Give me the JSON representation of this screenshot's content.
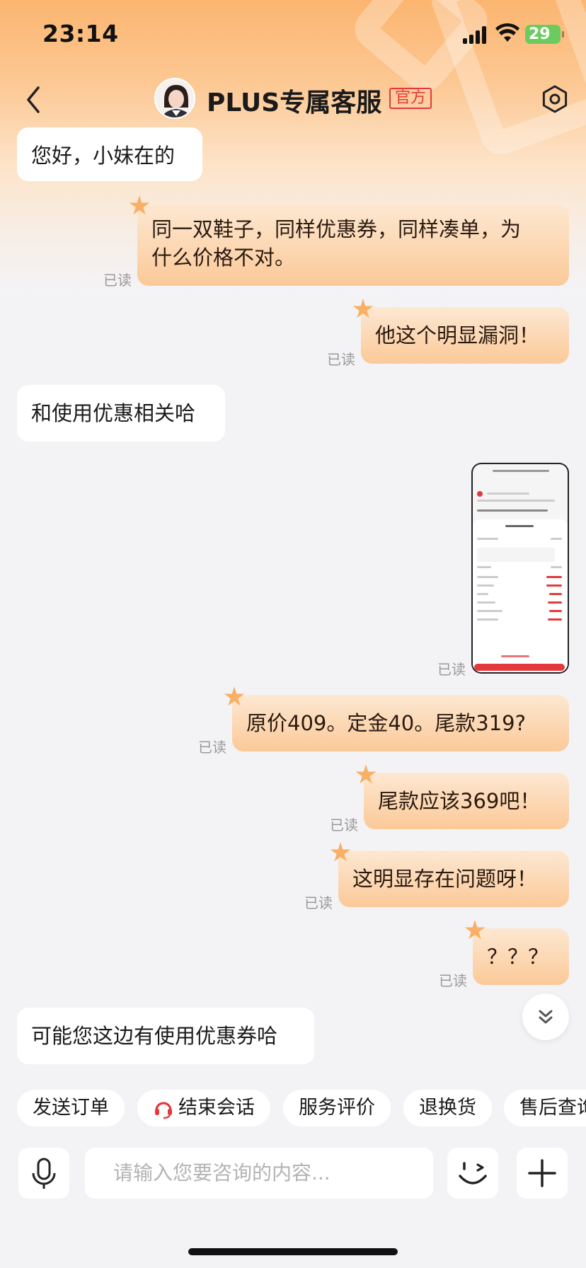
{
  "status": {
    "time": "23:14",
    "battery": "29"
  },
  "header": {
    "title": "PLUS专属客服",
    "badge": "官方"
  },
  "messages": {
    "m1": "您好，小妹在的",
    "m2_line1": "同一双鞋子，同样优惠券，同样凑单，为",
    "m2_line2": "什么价格不对。",
    "m3": "他这个明显漏洞！",
    "m4": "和使用优惠相关哈",
    "m5": "原价409。定金40。尾款319?",
    "m6": "尾款应该369吧！",
    "m7": "这明显存在问题呀！",
    "m8": "？？？",
    "m9": "可能您这边有使用优惠券哈"
  },
  "read_label": "已读",
  "quick_replies": [
    "发送订单",
    "结束会话",
    "服务评价",
    "退换货",
    "售后查询"
  ],
  "input": {
    "placeholder": "请输入您要咨询的内容..."
  },
  "icons": [
    "back-icon",
    "settings-icon",
    "microphone-icon",
    "emoji-icon",
    "plus-icon",
    "headset-icon",
    "double-chevron-down-icon"
  ],
  "colors": {
    "accent": "#e4393c",
    "bubble_right": "#fbc998",
    "bubble_left": "#ffffff",
    "background": "#f3f3f6"
  }
}
